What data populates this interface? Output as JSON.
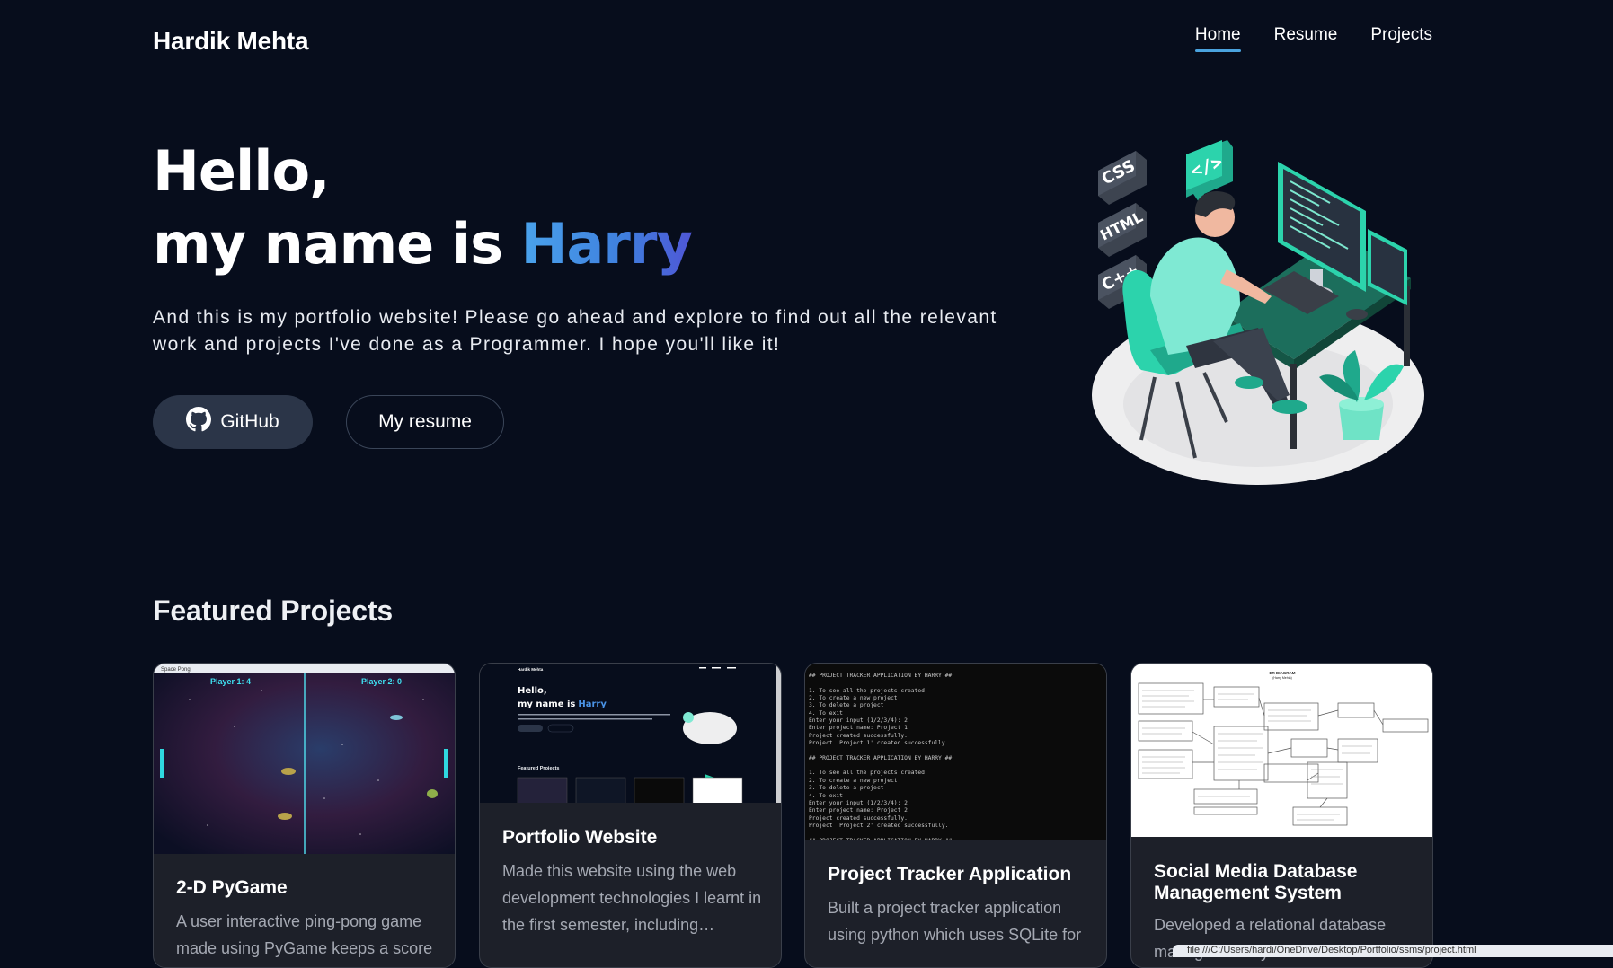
{
  "nav": {
    "brand": "Hardik Mehta",
    "links": [
      "Home",
      "Resume",
      "Projects"
    ],
    "active": "Home"
  },
  "hero": {
    "line1": "Hello,",
    "line2_prefix": "my name is ",
    "name": "Harry",
    "description": "And this is my portfolio website! Please go ahead and explore to find out all the relevant work and projects I've done as a Programmer. I hope you'll like it!",
    "github_label": "GitHub",
    "resume_label": "My resume",
    "illustration_tags": [
      "CSS",
      "HTML",
      "C++"
    ]
  },
  "featured": {
    "title": "Featured Projects",
    "cards": [
      {
        "title": "2-D PyGame",
        "desc": "A user interactive ping-pong game made using PyGame keeps a score",
        "thumb": {
          "window_title": "Space Pong",
          "p1": "Player 1: 4",
          "p2": "Player 2: 0"
        }
      },
      {
        "title": "Portfolio Website",
        "desc": "Made this website using the web development technologies I learnt in the first semester, including…",
        "thumb": {
          "brand": "Hardik Mehta",
          "l1": "Hello,",
          "l2": "my name is",
          "name": "Harry",
          "fp": "Featured Projects"
        }
      },
      {
        "title": "Project Tracker Application",
        "desc": "Built a project tracker application using python which uses SQLite for",
        "thumb": {
          "lines": [
            "## PROJECT TRACKER APPLICATION BY HARRY ##",
            "",
            "1. To see all the projects created",
            "2. To create a new project",
            "3. To delete a project",
            "4. To exit",
            "Enter your input (1/2/3/4): 2",
            "Enter project name: Project 1",
            "Project created successfully.",
            "Project 'Project 1' created successfully.",
            "",
            "## PROJECT TRACKER APPLICATION BY HARRY ##",
            "",
            "1. To see all the projects created",
            "2. To create a new project",
            "3. To delete a project",
            "4. To exit",
            "Enter your input (1/2/3/4): 2",
            "Enter project name: Project 2",
            "Project created successfully.",
            "Project 'Project 2' created successfully.",
            "",
            "## PROJECT TRACKER APPLICATION BY HARRY ##"
          ]
        }
      },
      {
        "title": "Social Media Database Management System",
        "desc": "Developed a relational database management system",
        "thumb": {
          "title": "ER DIAGRAM",
          "subtitle": "(Harry Mehta)"
        }
      }
    ]
  },
  "status_bar": "file:///C:/Users/hardi/OneDrive/Desktop/Portfolio/ssms/project.html"
}
